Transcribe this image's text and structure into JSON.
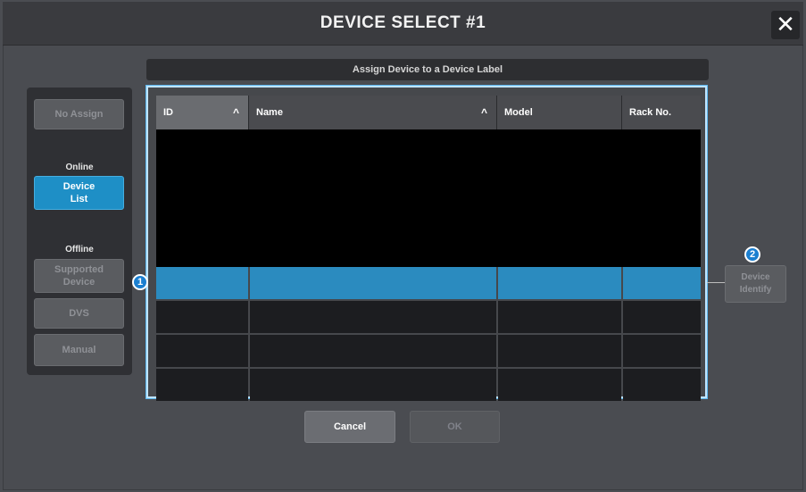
{
  "dialog": {
    "title": "DEVICE SELECT #1",
    "close_label": "✕"
  },
  "assign_label": "Assign Device to a Device Label",
  "left": {
    "no_assign": "No Assign",
    "online_label": "Online",
    "device_list": "Device\nList",
    "offline_label": "Offline",
    "supported_device": "Supported\nDevice",
    "dvs": "DVS",
    "manual": "Manual"
  },
  "table": {
    "columns": [
      "ID",
      "Name",
      "Model",
      "Rack No."
    ],
    "sort_indicators": {
      "id": "^",
      "name": "^"
    },
    "rows": [
      {
        "id": "",
        "name": "",
        "model": "",
        "rack": "",
        "selected": true
      },
      {
        "id": "",
        "name": "",
        "model": "",
        "rack": "",
        "selected": false
      },
      {
        "id": "",
        "name": "",
        "model": "",
        "rack": "",
        "selected": false
      },
      {
        "id": "",
        "name": "",
        "model": "",
        "rack": "",
        "selected": false
      }
    ]
  },
  "device_identify": "Device\nIdentify",
  "badges": {
    "one": "1",
    "two": "2"
  },
  "footer": {
    "cancel": "Cancel",
    "ok": "OK"
  },
  "colors": {
    "accent_blue": "#1e8fc6",
    "selected_row": "#2b8bbf",
    "highlight_border": "#bfe4ff"
  }
}
